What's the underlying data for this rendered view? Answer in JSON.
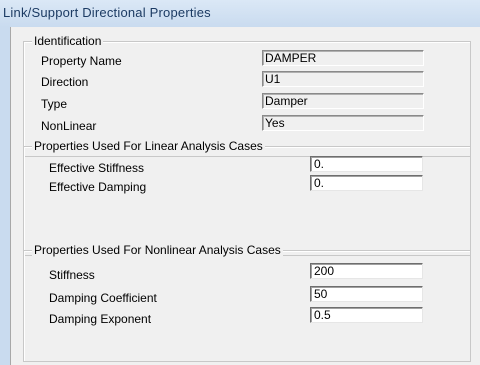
{
  "window": {
    "title": "Link/Support Directional Properties"
  },
  "identification": {
    "group_title": "Identification",
    "property_name": {
      "label": "Property Name",
      "value": "DAMPER"
    },
    "direction": {
      "label": "Direction",
      "value": "U1"
    },
    "type": {
      "label": "Type",
      "value": "Damper"
    },
    "nonlinear": {
      "label": "NonLinear",
      "value": "Yes"
    }
  },
  "linear": {
    "group_title": "Properties Used For Linear Analysis Cases",
    "effective_stiffness": {
      "label": "Effective Stiffness",
      "value": "0."
    },
    "effective_damping": {
      "label": "Effective Damping",
      "value": "0."
    }
  },
  "nonlinear_props": {
    "group_title": "Properties Used For Nonlinear Analysis Cases",
    "stiffness": {
      "label": "Stiffness",
      "value": "200"
    },
    "damping_coefficient": {
      "label": "Damping Coefficient",
      "value": "50"
    },
    "damping_exponent": {
      "label": "Damping Exponent",
      "value": "0.5"
    }
  }
}
